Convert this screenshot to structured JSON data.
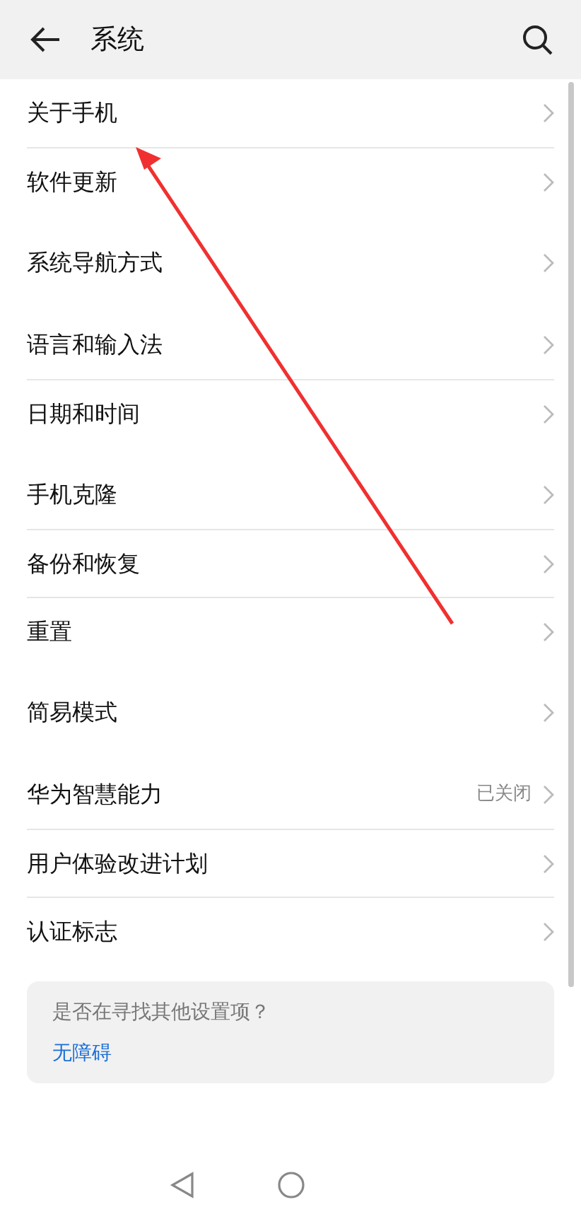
{
  "header": {
    "title": "系统"
  },
  "groups": [
    {
      "items": [
        {
          "label": "关于手机"
        },
        {
          "label": "软件更新"
        }
      ]
    },
    {
      "items": [
        {
          "label": "系统导航方式"
        }
      ]
    },
    {
      "items": [
        {
          "label": "语言和输入法"
        },
        {
          "label": "日期和时间"
        }
      ]
    },
    {
      "items": [
        {
          "label": "手机克隆"
        },
        {
          "label": "备份和恢复"
        },
        {
          "label": "重置"
        }
      ]
    },
    {
      "items": [
        {
          "label": "简易模式"
        }
      ]
    },
    {
      "items": [
        {
          "label": "华为智慧能力",
          "value": "已关闭"
        },
        {
          "label": "用户体验改进计划"
        },
        {
          "label": "认证标志"
        }
      ]
    }
  ],
  "suggestion": {
    "question": "是否在寻找其他设置项？",
    "link": "无障碍"
  }
}
